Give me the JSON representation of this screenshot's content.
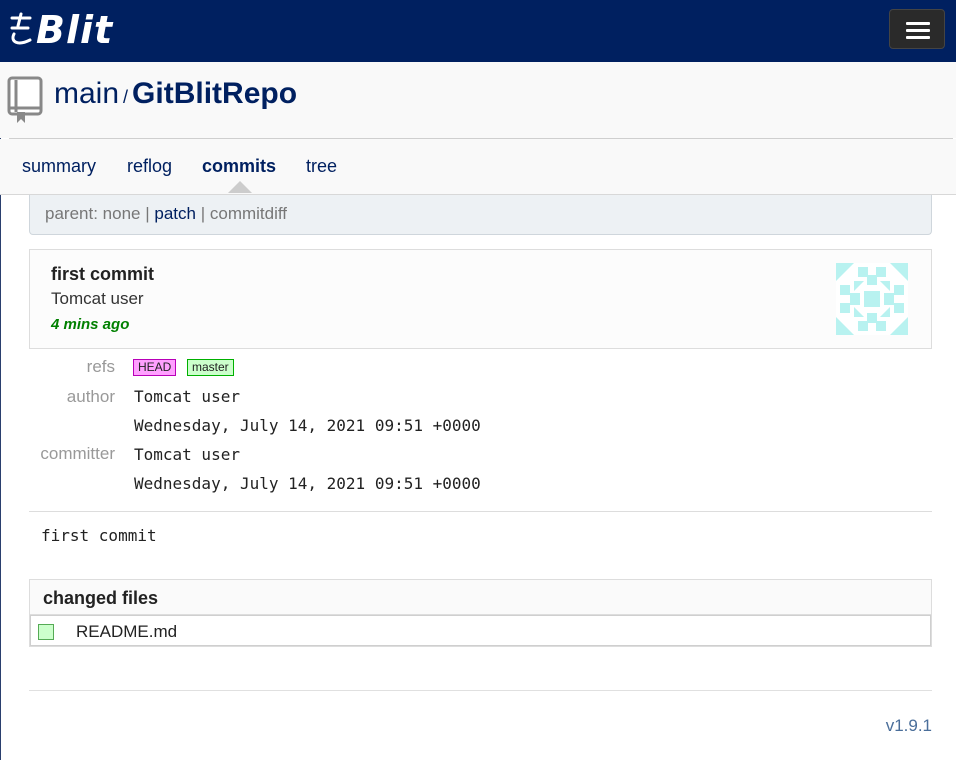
{
  "app": {
    "name": "Blit",
    "brand_prefix": "ಹ",
    "version": "v1.9.1"
  },
  "repo": {
    "project": "main",
    "separator": "/",
    "name": "GitBlitRepo"
  },
  "tabs": [
    {
      "label": "summary",
      "active": false
    },
    {
      "label": "reflog",
      "active": false
    },
    {
      "label": "commits",
      "active": true
    },
    {
      "label": "tree",
      "active": false
    }
  ],
  "commit_nav": {
    "parent_label": "parent:",
    "parent_value": "none",
    "sep": "|",
    "patch": "patch",
    "commitdiff": "commitdiff"
  },
  "commit": {
    "title": "first commit",
    "author_name": "Tomcat user",
    "age": "4 mins ago",
    "refs_label": "refs",
    "refs": [
      {
        "label": "HEAD",
        "color": "#ffa0ff"
      },
      {
        "label": "master",
        "color": "#ccffcc"
      }
    ],
    "author_label": "author",
    "author": "Tomcat user",
    "author_date": "Wednesday, July 14, 2021 09:51 +0000",
    "committer_label": "committer",
    "committer": "Tomcat user",
    "committer_date": "Wednesday, July 14, 2021 09:51 +0000",
    "message": "first commit"
  },
  "changed_files": {
    "title": "changed files",
    "files": [
      {
        "name": "README.md",
        "status": "added",
        "status_color": "#ccffcc"
      }
    ]
  },
  "colors": {
    "navbar": "#002060",
    "link": "#002060",
    "age": "#008000",
    "gravatar": "#b8f2f0"
  }
}
